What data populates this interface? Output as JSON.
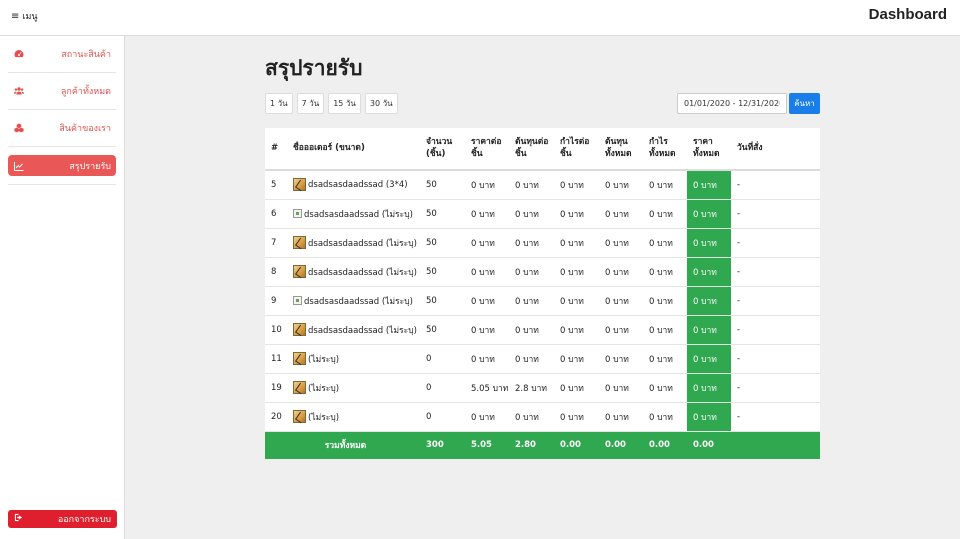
{
  "header": {
    "menu_label": "เมนู",
    "brand": "Dashboard"
  },
  "sidebar": {
    "items": [
      {
        "label": "สถานะสินค้า",
        "icon": "tachometer-icon",
        "active": false
      },
      {
        "label": "ลูกค้าทั้งหมด",
        "icon": "users-icon",
        "active": false
      },
      {
        "label": "สินค้าของเรา",
        "icon": "cubes-icon",
        "active": false
      },
      {
        "label": "สรุปรายรับ",
        "icon": "line-chart-icon",
        "active": true
      }
    ],
    "logout_label": "ออกจากระบบ"
  },
  "main": {
    "title": "สรุปรายรับ",
    "filters": [
      "1 วัน",
      "7 วัน",
      "15 วัน",
      "30 วัน"
    ],
    "date_range": "01/01/2020 - 12/31/2020",
    "search_label": "ค้นหา",
    "table": {
      "headers": [
        "#",
        "ชื่อออเดอร์ (ขนาด)",
        "จำนวน (ชิ้น)",
        "ราคาต่อ ชิ้น",
        "ต้นทุนต่อ ชิ้น",
        "กำไรต่อ ชิ้น",
        "ต้นทุน ทั้งหมด",
        "กำไร ทั้งหมด",
        "ราคา ทั้งหมด",
        "วันที่สั่ง"
      ],
      "rows": [
        {
          "id": "5",
          "thumb": "img",
          "name": "dsadsasdaadssad (3*4)",
          "qty": "50",
          "price": "0 บาท",
          "cost": "0 บาท",
          "profit": "0 บาท",
          "cost_total": "0 บาท",
          "profit_total": "0 บาท",
          "price_total": "0 บาท",
          "date": "-"
        },
        {
          "id": "6",
          "thumb": "broken",
          "name": "dsadsasdaadssad (ไม่ระบุ)",
          "qty": "50",
          "price": "0 บาท",
          "cost": "0 บาท",
          "profit": "0 บาท",
          "cost_total": "0 บาท",
          "profit_total": "0 บาท",
          "price_total": "0 บาท",
          "date": "-"
        },
        {
          "id": "7",
          "thumb": "img",
          "name": "dsadsasdaadssad (ไม่ระบุ)",
          "qty": "50",
          "price": "0 บาท",
          "cost": "0 บาท",
          "profit": "0 บาท",
          "cost_total": "0 บาท",
          "profit_total": "0 บาท",
          "price_total": "0 บาท",
          "date": "-"
        },
        {
          "id": "8",
          "thumb": "img",
          "name": "dsadsasdaadssad (ไม่ระบุ)",
          "qty": "50",
          "price": "0 บาท",
          "cost": "0 บาท",
          "profit": "0 บาท",
          "cost_total": "0 บาท",
          "profit_total": "0 บาท",
          "price_total": "0 บาท",
          "date": "-"
        },
        {
          "id": "9",
          "thumb": "broken",
          "name": "dsadsasdaadssad (ไม่ระบุ)",
          "qty": "50",
          "price": "0 บาท",
          "cost": "0 บาท",
          "profit": "0 บาท",
          "cost_total": "0 บาท",
          "profit_total": "0 บาท",
          "price_total": "0 บาท",
          "date": "-"
        },
        {
          "id": "10",
          "thumb": "img",
          "name": "dsadsasdaadssad (ไม่ระบุ)",
          "qty": "50",
          "price": "0 บาท",
          "cost": "0 บาท",
          "profit": "0 บาท",
          "cost_total": "0 บาท",
          "profit_total": "0 บาท",
          "price_total": "0 บาท",
          "date": "-"
        },
        {
          "id": "11",
          "thumb": "img",
          "name": "(ไม่ระบุ)",
          "qty": "0",
          "price": "0 บาท",
          "cost": "0 บาท",
          "profit": "0 บาท",
          "cost_total": "0 บาท",
          "profit_total": "0 บาท",
          "price_total": "0 บาท",
          "date": "-"
        },
        {
          "id": "19",
          "thumb": "img",
          "name": "(ไม่ระบุ)",
          "qty": "0",
          "price": "5.05 บาท",
          "cost": "2.8 บาท",
          "profit": "0 บาท",
          "cost_total": "0 บาท",
          "profit_total": "0 บาท",
          "price_total": "0 บาท",
          "date": "-"
        },
        {
          "id": "20",
          "thumb": "img",
          "name": "(ไม่ระบุ)",
          "qty": "0",
          "price": "0 บาท",
          "cost": "0 บาท",
          "profit": "0 บาท",
          "cost_total": "0 บาท",
          "profit_total": "0 บาท",
          "price_total": "0 บาท",
          "date": "-"
        }
      ],
      "totals": {
        "label": "รวมทั้งหมด",
        "qty": "300",
        "price": "5.05",
        "cost": "2.80",
        "profit": "0.00",
        "cost_total": "0.00",
        "profit_total": "0.00",
        "price_total": "0.00"
      }
    }
  },
  "colors": {
    "accent_red": "#e95757",
    "logout_red": "#e01f2e",
    "total_green": "#2fa84f",
    "search_blue": "#1a7ee8"
  }
}
